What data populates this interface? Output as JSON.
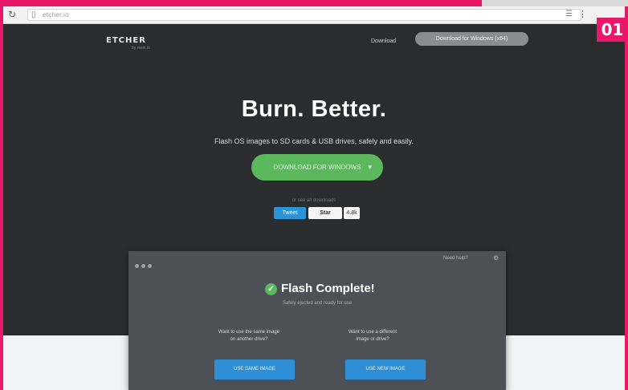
{
  "browser": {
    "reload_icon": "reload-icon",
    "url": "etcher.io",
    "menu_icon": "menu-icon"
  },
  "badge": "01",
  "nav": {
    "logo": "ETCHER",
    "logo_sub": "by resin.io",
    "link": "Download",
    "button": "Download for Windows (x64)"
  },
  "hero": {
    "title": "Burn. Better.",
    "subtitle": "Flash OS images to SD cards & USB drives, safely and easily.",
    "download_button": "DOWNLOAD FOR WINDOWS",
    "caption": "or see all downloads",
    "tweet": "Tweet",
    "github": "Star",
    "count": "4.8k"
  },
  "app": {
    "help": "Need help?",
    "title": "Flash Complete!",
    "subtitle": "Safely ejected and ready for use",
    "left_text_1": "Want to use the same image",
    "left_text_2": "on another drive?",
    "right_text_1": "Want to use a different",
    "right_text_2": "image or drive?",
    "left_button": "USE SAME IMAGE",
    "right_button": "USE NEW IMAGE"
  }
}
